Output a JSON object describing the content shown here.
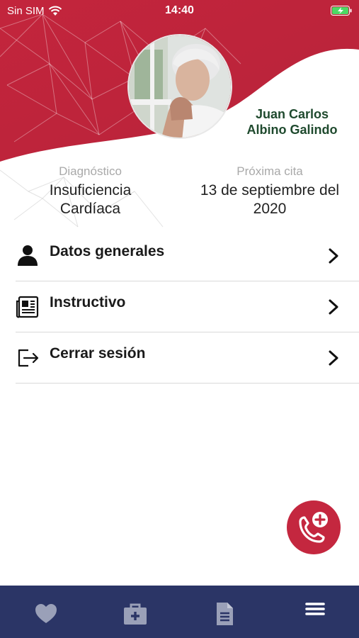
{
  "status_bar": {
    "carrier": "Sin SIM",
    "time": "14:40",
    "wifi_icon": "wifi-icon",
    "battery_icon": "battery-charging-icon"
  },
  "profile": {
    "name_line1": "Juan Carlos",
    "name_line2": "Albino Galindo",
    "photo": "elderly-person-photo"
  },
  "diagnosis": {
    "label": "Diagnóstico",
    "value_line1": "Insuficiencia",
    "value_line2": "Cardíaca"
  },
  "appointment": {
    "label": "Próxima cita",
    "value_line1": "13 de septiembre del",
    "value_line2": "2020"
  },
  "menu": {
    "items": [
      {
        "label": "Datos generales",
        "icon": "user-icon"
      },
      {
        "label": "Instructivo",
        "icon": "document-icon"
      },
      {
        "label": "Cerrar sesión",
        "icon": "logout-icon"
      }
    ]
  },
  "fab": {
    "icon": "emergency-call-icon"
  },
  "tabbar": {
    "tabs": [
      {
        "icon": "heart-icon"
      },
      {
        "icon": "medical-kit-icon"
      },
      {
        "icon": "file-icon"
      },
      {
        "icon": "menu-icon",
        "active": true
      }
    ]
  },
  "colors": {
    "brand_red": "#c4273f",
    "tabbar_navy": "#2b3566",
    "name_green": "#1f4a2e",
    "label_gray": "#a9a9a9"
  }
}
